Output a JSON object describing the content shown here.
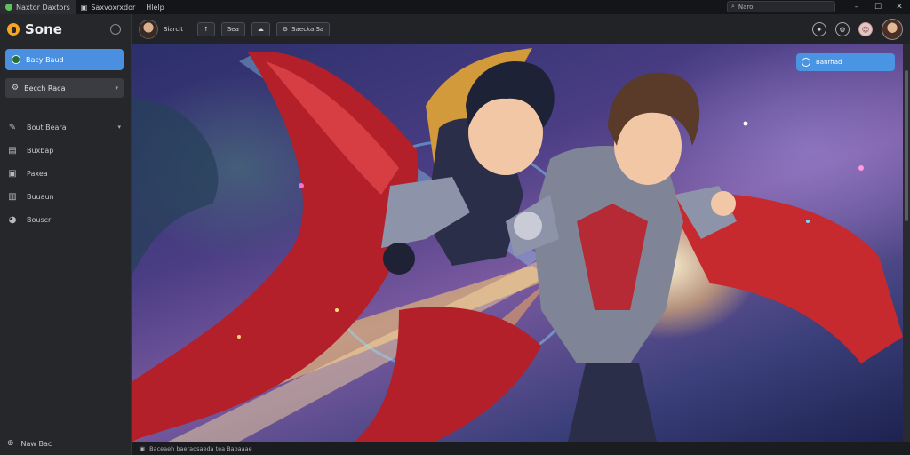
{
  "titlebar": {
    "tabs": [
      {
        "label": "Naxtor Daxtors",
        "icon": "green-circle-icon"
      },
      {
        "label": "Saxvoxrxdor",
        "icon": "document-icon"
      },
      {
        "label": "Hlelp",
        "icon": ""
      }
    ],
    "search_value": "Naro",
    "window_controls": [
      "minimize",
      "maximize",
      "close"
    ]
  },
  "sidebar": {
    "app_name": "Sone",
    "primary_item": {
      "label": "Bacy Baud",
      "icon": "avatar-icon"
    },
    "secondary_item": {
      "label": "Becch Raca",
      "icon": "settings-icon"
    },
    "items": [
      {
        "label": "Bout Beara",
        "icon": "pen-icon",
        "has_chevron": true
      },
      {
        "label": "Buxbap",
        "icon": "chart-icon",
        "has_chevron": false
      },
      {
        "label": "Paxea",
        "icon": "box-icon",
        "has_chevron": false
      },
      {
        "label": "Buuaun",
        "icon": "list-icon",
        "has_chevron": false
      },
      {
        "label": "Bouscr",
        "icon": "shield-icon",
        "has_chevron": false
      }
    ],
    "footer_label": "Naw Bac"
  },
  "toolbar": {
    "user_label": "Siarcit",
    "buttons": [
      {
        "label": "",
        "icon": "arrow-up-icon"
      },
      {
        "label": "Sea",
        "icon": ""
      },
      {
        "label": "",
        "icon": "cloud-icon"
      },
      {
        "label": "Saecka Sa",
        "icon": "gear-icon"
      }
    ]
  },
  "canvas": {
    "overlay_button_label": "Banrhad"
  },
  "statusbar": {
    "text": "Baceaeh baeraosaeda tea Baoaaae"
  },
  "colors": {
    "accent": "#4a8fe0",
    "logo": "#f5a623",
    "sidebar_bg": "#26272b"
  }
}
